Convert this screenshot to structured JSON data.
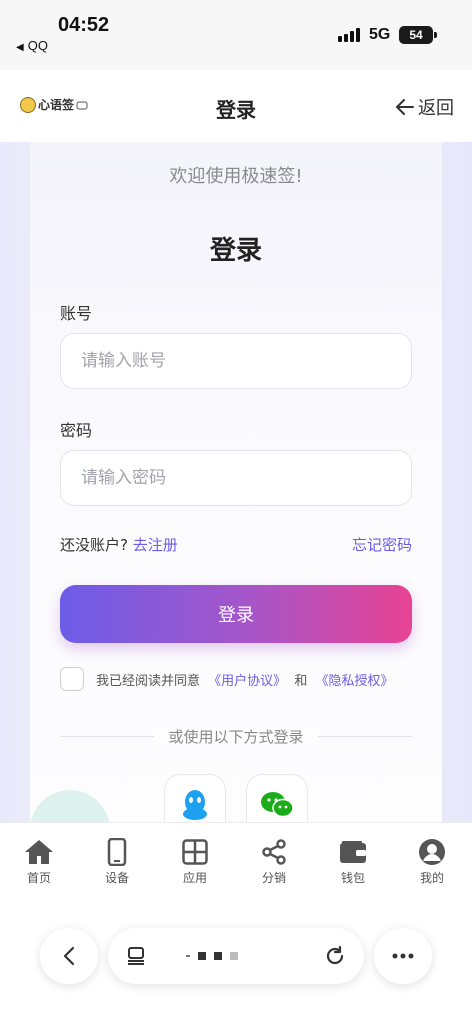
{
  "status_bar": {
    "time": "04:52",
    "back_app": "QQ",
    "network": "5G",
    "battery": "54"
  },
  "header": {
    "logo_text": "心语签",
    "title": "登录",
    "back_label": "返回"
  },
  "form": {
    "welcome": "欢迎使用极速签!",
    "title": "登录",
    "account_label": "账号",
    "account_placeholder": "请输入账号",
    "password_label": "密码",
    "password_placeholder": "请输入密码",
    "no_account_text": "还没账户?",
    "register_link": "去注册",
    "forgot_link": "忘记密码",
    "login_button": "登录",
    "agree_prefix": "我已经阅读并同意",
    "user_agreement": "《用户协议》",
    "and_text": "和",
    "privacy_policy": "《隐私授权》",
    "divider_text": "或使用以下方式登录"
  },
  "social": [
    {
      "name": "qq",
      "icon": "qq-icon",
      "color": "#1ea0f0"
    },
    {
      "name": "wechat",
      "icon": "wechat-icon",
      "color": "#1aad19"
    }
  ],
  "tabbar": [
    {
      "label": "首页",
      "icon": "home-icon"
    },
    {
      "label": "设备",
      "icon": "device-icon"
    },
    {
      "label": "应用",
      "icon": "apps-icon"
    },
    {
      "label": "分销",
      "icon": "share-icon"
    },
    {
      "label": "钱包",
      "icon": "wallet-icon"
    },
    {
      "label": "我的",
      "icon": "profile-icon"
    }
  ],
  "colors": {
    "accent": "#6c5ce7",
    "gradient_start": "#6c5ce7",
    "gradient_end": "#e84393"
  }
}
